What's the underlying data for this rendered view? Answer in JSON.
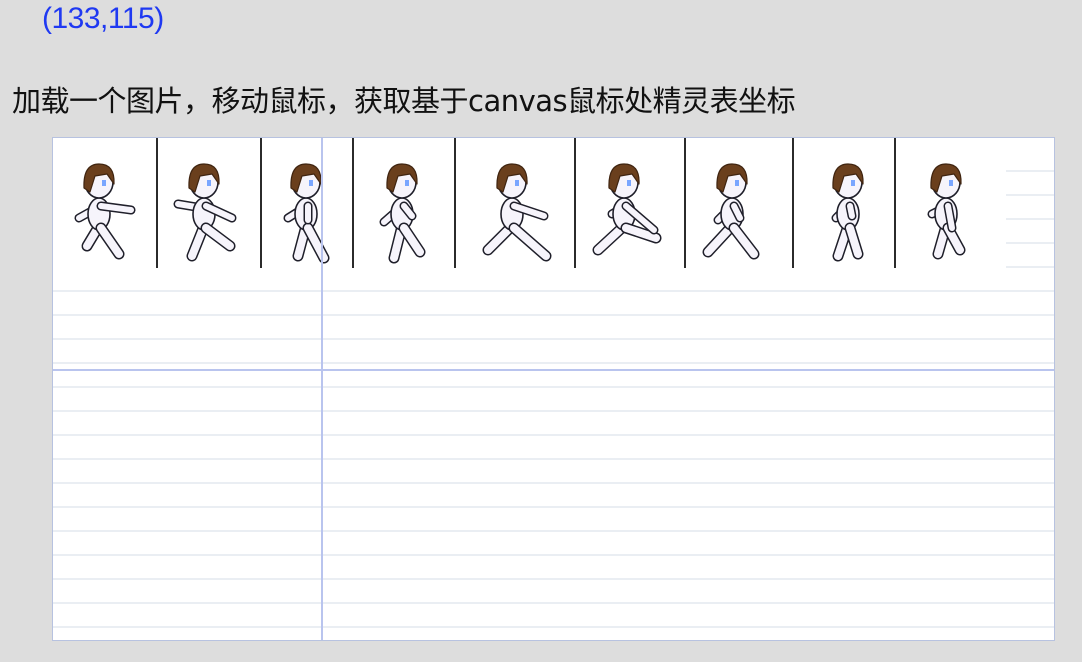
{
  "coords": {
    "label": "(133,115)"
  },
  "heading": {
    "text": "加载一个图片，移动鼠标，获取基于canvas鼠标处精灵表坐标"
  },
  "canvas": {
    "sprite_sheet": {
      "frame_count": 9,
      "colors": {
        "hair": "#6a3f1d",
        "hair_shadow": "#3f2410",
        "skin": "#f6f4fb",
        "outline": "#1f1f2a",
        "eye": "#79a6ff",
        "divider": "#2b2b2b"
      }
    },
    "colors": {
      "background": "#ffffff",
      "rule_line": "#eaeef3",
      "crosshair": "#b9c4ee"
    }
  }
}
